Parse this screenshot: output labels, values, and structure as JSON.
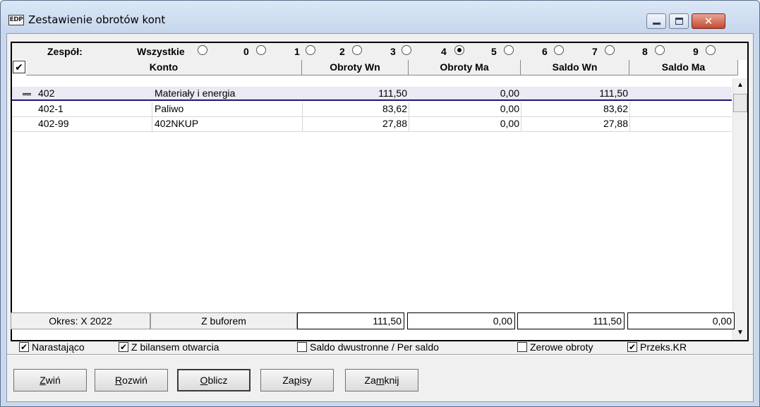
{
  "window": {
    "icon_text": "EDP",
    "title": "Zestawienie obrotów kont",
    "close_glyph": "✕"
  },
  "team": {
    "label": "Zespół:",
    "options": [
      {
        "label": "Wszystkie",
        "checked": false
      },
      {
        "label": "0",
        "checked": false
      },
      {
        "label": "1",
        "checked": false
      },
      {
        "label": "2",
        "checked": false
      },
      {
        "label": "3",
        "checked": false
      },
      {
        "label": "4",
        "checked": true
      },
      {
        "label": "5",
        "checked": false
      },
      {
        "label": "6",
        "checked": false
      },
      {
        "label": "7",
        "checked": false
      },
      {
        "label": "8",
        "checked": false
      },
      {
        "label": "9",
        "checked": false
      }
    ]
  },
  "columns": {
    "check_all": "✔",
    "konto": "Konto",
    "obroty_wn": "Obroty Wn",
    "obroty_ma": "Obroty Ma",
    "saldo_wn": "Saldo Wn",
    "saldo_ma": "Saldo Ma"
  },
  "rows": [
    {
      "account": "402",
      "name": "Materiały i energia",
      "obroty_wn": "111,50",
      "obroty_ma": "0,00",
      "saldo_wn": "111,50",
      "saldo_ma": ""
    },
    {
      "account": "402-1",
      "name": "Paliwo",
      "obroty_wn": "83,62",
      "obroty_ma": "0,00",
      "saldo_wn": "83,62",
      "saldo_ma": ""
    },
    {
      "account": "402-99",
      "name": "402NKUP",
      "obroty_wn": "27,88",
      "obroty_ma": "0,00",
      "saldo_wn": "27,88",
      "saldo_ma": ""
    }
  ],
  "scrollbar": {
    "up": "▲",
    "down": "▼"
  },
  "totals": {
    "period": "Okres: X 2022",
    "buffer": "Z buforem",
    "obroty_wn": "111,50",
    "obroty_ma": "0,00",
    "saldo_wn": "111,50",
    "saldo_ma": "0,00"
  },
  "options": [
    {
      "label": "Narastająco",
      "checked": true
    },
    {
      "label": "Z bilansem otwarcia",
      "checked": true
    },
    {
      "label": "Saldo dwustronne / Per saldo",
      "checked": false
    },
    {
      "label": "Zerowe obroty",
      "checked": false
    },
    {
      "label": "Przeks.KR",
      "checked": true
    }
  ],
  "buttons": {
    "collapse": {
      "u": "Z",
      "rest": "wiń"
    },
    "expand": {
      "u": "R",
      "rest": "ozwiń"
    },
    "compute": {
      "u": "O",
      "rest": "blicz"
    },
    "entries": {
      "pre": "Za",
      "u": "p",
      "rest": "isy"
    },
    "close": {
      "pre": "Za",
      "u": "m",
      "rest": "knij"
    }
  }
}
